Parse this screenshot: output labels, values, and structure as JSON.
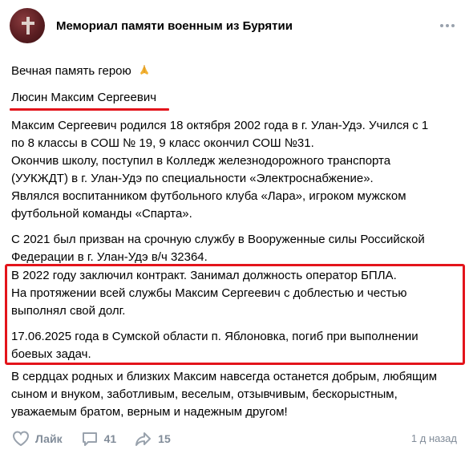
{
  "post": {
    "group_name": "Мемориал памяти военным из Бурятии",
    "intro": "Вечная память герою",
    "hero_name": "Люсин Максим Сергеевич",
    "p1": [
      "Максим Сергеевич родился 18 октября 2002 года в г. Улан-Удэ. Учился с 1",
      "по 8 классы в СОШ № 19, 9 класс окончил СОШ №31.",
      "Окончив школу, поступил в Колледж железнодорожного транспорта",
      "(УУКЖДТ) в г. Улан-Удэ по специальности «Электроснабжение».",
      "Являлся воспитанником футбольного клуба «Лара», игроком мужском",
      "футбольной команды «Спарта»."
    ],
    "p2": [
      "С 2021 был призван на срочную службу в Вооруженные силы Российской",
      "Федерации в г. Улан-Удэ в/ч 32364."
    ],
    "p3": [
      "В 2022 году заключил контракт. Занимал должность оператор БПЛА.",
      "На протяжении всей службы Максим Сергеевич с доблестью и честью",
      "выполнял свой долг."
    ],
    "p4": [
      "17.06.2025 года в Сумской области п. Яблоновка, погиб при выполнении",
      "боевых задач."
    ],
    "p5": [
      "В сердцах родных и близких Максим навсегда останется добрым, любящим",
      "сыном и внуком, заботливым, веселым, отзывчивым, бескорыстным,",
      "уважаемым братом, верным и надежным другом!"
    ]
  },
  "footer": {
    "like_label": "Лайк",
    "comments_count": "41",
    "shares_count": "15",
    "timestamp": "1 д назад"
  },
  "icons": {
    "avatar": "memorial-cross-avatar",
    "more": "more-dots-icon",
    "praise": "folded-hands-emoji",
    "like": "heart-icon",
    "comment": "comment-icon",
    "share": "share-icon"
  },
  "colors": {
    "accent_red": "#e3141b",
    "muted_gray": "#818c99"
  }
}
